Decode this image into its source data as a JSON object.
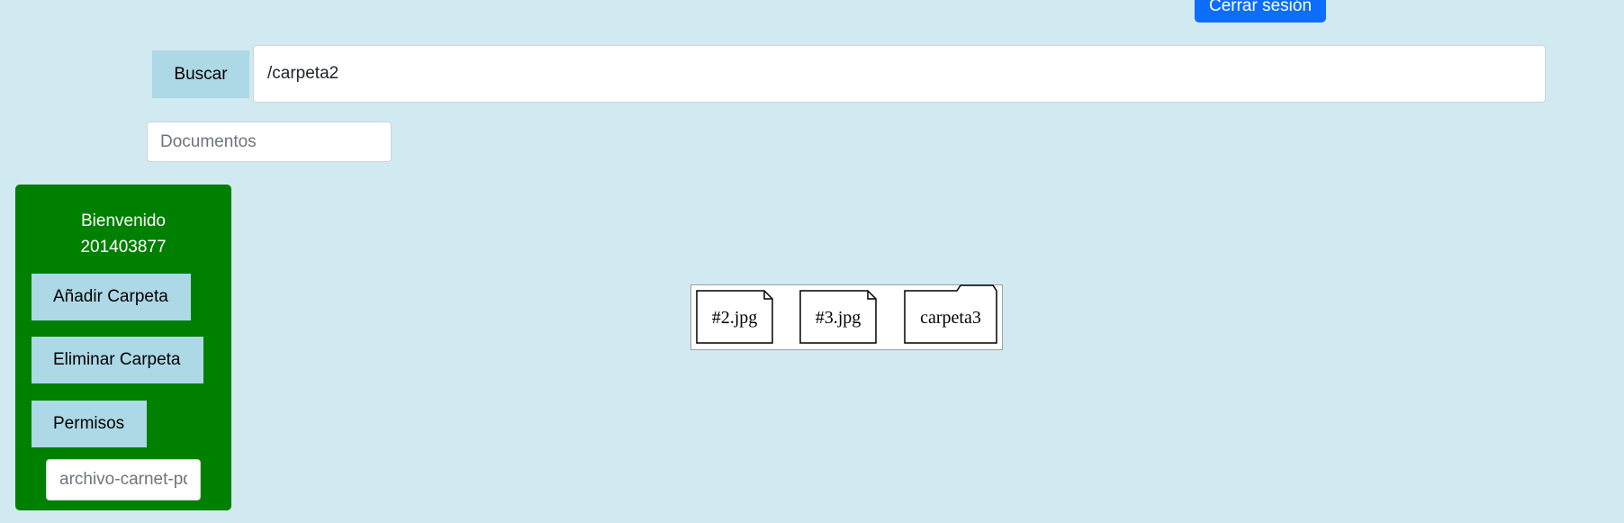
{
  "header": {
    "logout_label": "Cerrar sesión"
  },
  "search": {
    "button_label": "Buscar",
    "path_value": "/carpeta2"
  },
  "documents": {
    "placeholder": "Documentos"
  },
  "sidebar": {
    "welcome_line1": "Bienvenido",
    "welcome_line2": "201403877",
    "add_folder_label": "Añadir Carpeta",
    "delete_folder_label": "Eliminar Carpeta",
    "permissions_label": "Permisos",
    "file_input_placeholder": "archivo-carnet-pdf"
  },
  "graph": {
    "nodes": [
      {
        "label": "#2.jpg",
        "type": "file"
      },
      {
        "label": "#3.jpg",
        "type": "file"
      },
      {
        "label": "carpeta3",
        "type": "folder"
      }
    ]
  },
  "colors": {
    "background": "#d1e9f0",
    "logout_button": "#0d6efd",
    "light_button": "#add8e6",
    "sidebar": "#008000"
  }
}
